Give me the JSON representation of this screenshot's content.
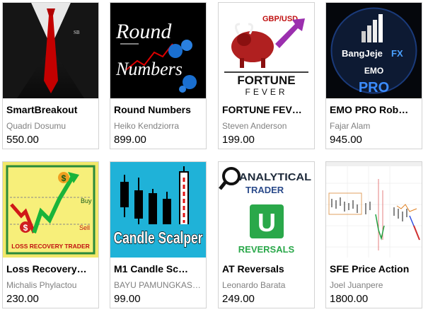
{
  "products": [
    {
      "title": "SmartBreakout",
      "author": "Quadri Dosumu",
      "price": "550.00",
      "image_text": "SB"
    },
    {
      "title": "Round Numbers",
      "author": "Heiko Kendziorra",
      "price": "899.00",
      "image_text_1": "Round",
      "image_text_2": "Numbers"
    },
    {
      "title": "FORTUNE FEV…",
      "author": "Steven Anderson",
      "price": "199.00",
      "image_text_1": "GBP/USD",
      "image_text_2": "FORTUNE",
      "image_text_3": "FEVER"
    },
    {
      "title": "EMO PRO Rob…",
      "author": "Fajar Alam",
      "price": "945.00",
      "image_text_1": "BangJeje",
      "image_text_2": "FX",
      "image_text_3": "EMO",
      "image_text_4": "PRO"
    },
    {
      "title": "Loss Recovery…",
      "author": "Michalis Phylactou",
      "price": "230.00",
      "image_text_1": "LOSS RECOVERY TRADER",
      "image_text_2": "Buy",
      "image_text_3": "Sell",
      "image_text_4": "$"
    },
    {
      "title": "M1 Candle Sc…",
      "author": "BAYU PAMUNGKAS…",
      "price": "99.00",
      "image_text": "Candle Scalper"
    },
    {
      "title": "AT Reversals",
      "author": "Leonardo Barata",
      "price": "249.00",
      "image_text_1": "ANALYTICAL",
      "image_text_2": "TRADER",
      "image_text_3": "REVERSALS",
      "image_text_4": "U"
    },
    {
      "title": "SFE Price Action",
      "author": "Joel Juanpere",
      "price": "1800.00"
    }
  ]
}
